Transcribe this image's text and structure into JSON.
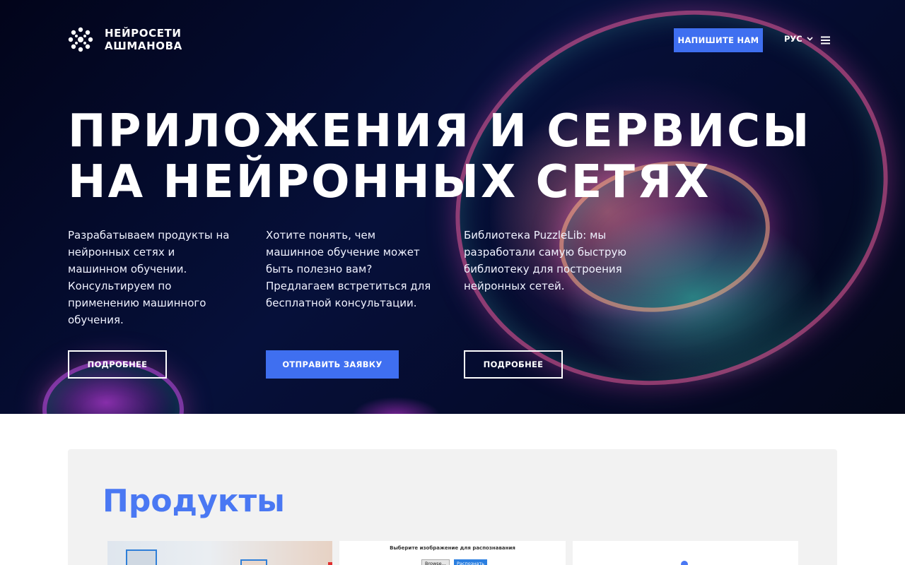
{
  "header": {
    "logo_line1": "НЕЙРОСЕТИ",
    "logo_line2": "АШМАНОВА",
    "write_us": "НАПИШИТЕ НАМ",
    "language": "РУС"
  },
  "hero": {
    "title_line1": "ПРИЛОЖЕНИЯ И СЕРВИСЫ",
    "title_line2": "НА НЕЙРОННЫХ СЕТЯХ",
    "columns": [
      {
        "text": "Разрабатываем продукты на нейронных сетях и машинном обучении. Консультируем по применению машинного обучения.",
        "button": "ПОДРОБНЕЕ"
      },
      {
        "text": "Хотите понять, чем машинное обучение может быть полезно вам? Предлагаем встретиться для бесплатной консультации.",
        "button": "ОТПРАВИТЬ ЗАЯВКУ"
      },
      {
        "text": "Библиотека PuzzleLib: мы разработали самую быструю библиотеку для построения нейронных сетей.",
        "button": "ПОДРОБНЕЕ"
      }
    ]
  },
  "products": {
    "title": "Продукты",
    "card2_caption": "Выберите изображение для распознавания",
    "card2_browse": "Browse...",
    "card2_recognize": "Распознать"
  },
  "colors": {
    "accent": "#3f6ff0",
    "products_title": "#4a78f3",
    "hero_bg": "#050b2c"
  },
  "icons": [
    "logo-icon",
    "chevron-down-icon",
    "menu-icon"
  ]
}
